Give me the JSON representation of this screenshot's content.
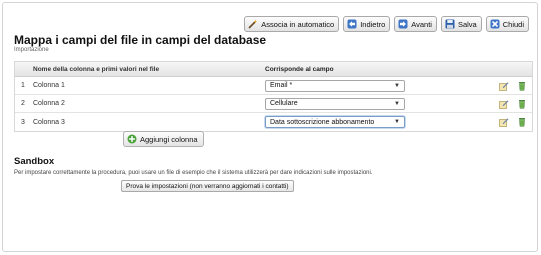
{
  "toolbar": {
    "auto_label": "Associa in automatico",
    "back_label": "Indietro",
    "next_label": "Avanti",
    "save_label": "Salva",
    "close_label": "Chiudi"
  },
  "header": {
    "title": "Mappa i campi del file in campi del database",
    "subtitle": "Importazione"
  },
  "table": {
    "headers": {
      "name": "Nome della colonna e primi valori nel file",
      "field": "Corrisponde al campo"
    },
    "rows": [
      {
        "num": "1",
        "name": "Colonna 1",
        "field": "Email *"
      },
      {
        "num": "2",
        "name": "Colonna 2",
        "field": "Cellulare"
      },
      {
        "num": "3",
        "name": "Colonna 3",
        "field": "Data sottoscrizione abbonamento"
      }
    ]
  },
  "add_column_label": "Aggiungi colonna",
  "sandbox": {
    "title": "Sandbox",
    "text": "Per impostare correttamente la procedura, puoi usare un file di esempio che il sistema utilizzerà per dare indicazioni sulle impostazioni.",
    "button_label": "Prova le impostazioni (non verranno aggiornati i contatti)"
  },
  "icons": {
    "auto": "wand-icon",
    "back": "arrow-left-icon",
    "next": "arrow-right-icon",
    "save": "floppy-disk-icon",
    "close": "close-x-icon",
    "edit": "edit-icon",
    "delete": "trash-icon",
    "add": "plus-circle-icon"
  }
}
